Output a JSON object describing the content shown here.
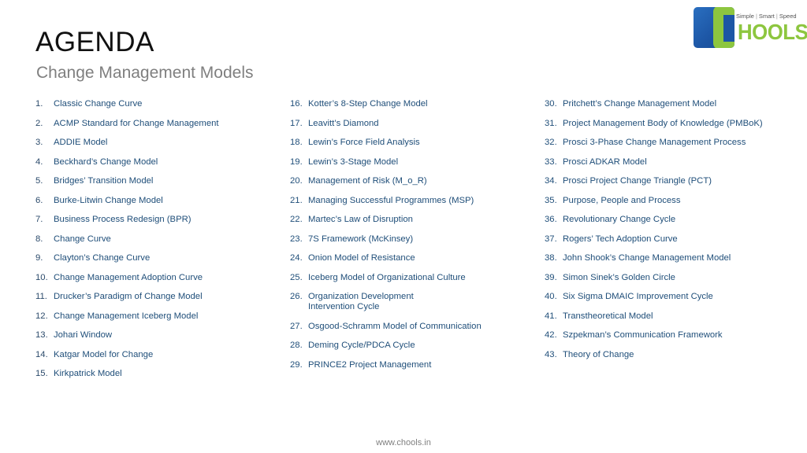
{
  "header": {
    "title": "AGENDA",
    "subtitle": "Change Management Models"
  },
  "logo": {
    "tagline": [
      "Simple",
      "Smart",
      "Speed"
    ],
    "separator": "|",
    "wordmark": "HOOLS",
    "brand_colors": {
      "blue": "#1d56a5",
      "green": "#8dc63f"
    }
  },
  "agenda": {
    "columns": [
      {
        "items": [
          {
            "num": "1.",
            "label": "Classic Change Curve"
          },
          {
            "num": "2.",
            "label": "ACMP Standard for Change Management"
          },
          {
            "num": "3.",
            "label": "ADDIE Model"
          },
          {
            "num": "4.",
            "label": "Beckhard’s Change Model"
          },
          {
            "num": "5.",
            "label": "Bridges’ Transition Model"
          },
          {
            "num": "6.",
            "label": "Burke-Litwin Change Model"
          },
          {
            "num": "7.",
            "label": "Business Process Redesign (BPR)"
          },
          {
            "num": "8.",
            "label": "Change Curve"
          },
          {
            "num": "9.",
            "label": "Clayton’s Change Curve"
          },
          {
            "num": "10.",
            "label": "Change Management Adoption Curve"
          },
          {
            "num": "11.",
            "label": "Drucker’s Paradigm of Change Model"
          },
          {
            "num": "12.",
            "label": "Change Management Iceberg Model"
          },
          {
            "num": "13.",
            "label": "Johari Window"
          },
          {
            "num": "14.",
            "label": "Katgar Model for Change"
          },
          {
            "num": "15.",
            "label": "Kirkpatrick Model"
          }
        ]
      },
      {
        "items": [
          {
            "num": "16.",
            "label": "Kotter’s 8-Step Change Model"
          },
          {
            "num": "17.",
            "label": "Leavitt’s Diamond"
          },
          {
            "num": "18.",
            "label": "Lewin’s Force Field Analysis"
          },
          {
            "num": "19.",
            "label": "Lewin’s 3-Stage Model"
          },
          {
            "num": "20.",
            "label": "Management of Risk (M_o_R)"
          },
          {
            "num": "21.",
            "label": "Managing Successful Programmes (MSP)"
          },
          {
            "num": "22.",
            "label": "Martec’s Law of Disruption"
          },
          {
            "num": "23.",
            "label": "7S Framework (McKinsey)"
          },
          {
            "num": "24.",
            "label": "Onion Model of Resistance"
          },
          {
            "num": "25.",
            "label": "Iceberg Model of Organizational Culture"
          },
          {
            "num": "26.",
            "label": "Organization Development\nIntervention Cycle"
          },
          {
            "num": "27.",
            "label": "Osgood-Schramm Model of Communication"
          },
          {
            "num": "28.",
            "label": "Deming Cycle/PDCA Cycle"
          },
          {
            "num": "29.",
            "label": "PRINCE2 Project Management"
          }
        ]
      },
      {
        "items": [
          {
            "num": "30.",
            "label": "Pritchett’s Change Management Model"
          },
          {
            "num": "31.",
            "label": "Project Management Body of Knowledge (PMBoK)"
          },
          {
            "num": "32.",
            "label": "Prosci 3-Phase Change Management Process"
          },
          {
            "num": "33.",
            "label": "Prosci ADKAR Model"
          },
          {
            "num": "34.",
            "label": "Prosci Project Change Triangle (PCT)"
          },
          {
            "num": "35.",
            "label": "Purpose, People and Process"
          },
          {
            "num": "36.",
            "label": "Revolutionary Change Cycle"
          },
          {
            "num": "37.",
            "label": "Rogers’ Tech Adoption Curve"
          },
          {
            "num": "38.",
            "label": "John Shook’s Change Management Model"
          },
          {
            "num": "39.",
            "label": "Simon Sinek’s Golden Circle"
          },
          {
            "num": "40.",
            "label": "Six Sigma DMAIC Improvement Cycle"
          },
          {
            "num": "41.",
            "label": "Transtheoretical Model"
          },
          {
            "num": "42.",
            "label": "Szpekman’s Communication Framework"
          },
          {
            "num": "43.",
            "label": "Theory of Change"
          }
        ]
      }
    ]
  },
  "footer": {
    "url": "www.chools.in"
  }
}
